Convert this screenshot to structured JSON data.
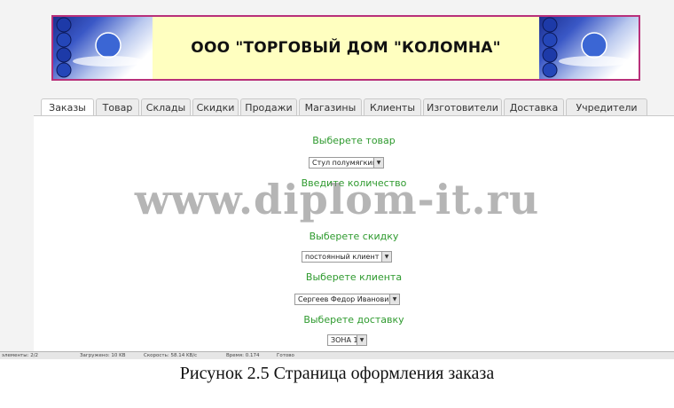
{
  "banner": {
    "title": "ООО \"ТОРГОВЫЙ ДОМ \"КОЛОМНА\""
  },
  "tabs": [
    {
      "label": "Заказы",
      "active": true
    },
    {
      "label": "Товар"
    },
    {
      "label": "Склады"
    },
    {
      "label": "Скидки"
    },
    {
      "label": "Продажи"
    },
    {
      "label": "Магазины"
    },
    {
      "label": "Клиенты"
    },
    {
      "label": "Изготовители"
    },
    {
      "label": "Доставка"
    },
    {
      "label": "Учредители"
    }
  ],
  "form": {
    "product_label": "Выберете товар",
    "product_value": "Стул полумягкий",
    "quantity_label": "Введите количество",
    "discount_label": "Выберете скидку",
    "discount_value": "постоянный клиент",
    "client_label": "Выберете клиента",
    "client_value": "Сергеев Федор Иванович",
    "delivery_label": "Выберете доставку",
    "delivery_value": "ЗОНА 1"
  },
  "watermark": "www.diplom-it.ru",
  "statusbar": {
    "elements": "элементы: 2/2",
    "loaded": "Загружено: 10 KB",
    "speed": "Скорость: 58.14 KB/c",
    "time": "Время: 0.174",
    "ready": "Готово"
  },
  "caption": "Рисунок 2.5 Страница оформления заказа"
}
